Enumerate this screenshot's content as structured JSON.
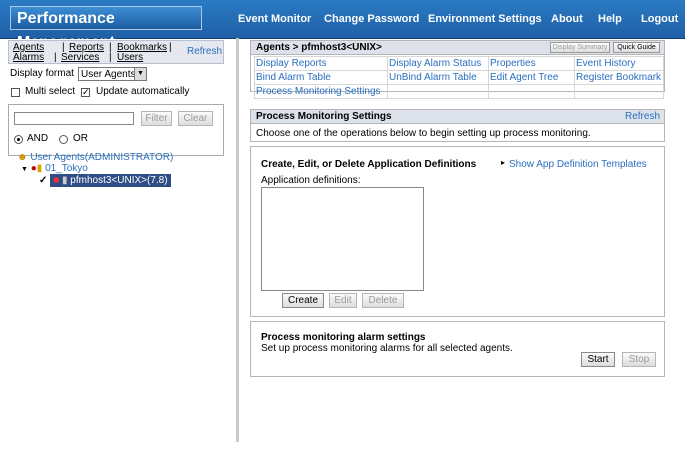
{
  "app": {
    "title": "Performance Management"
  },
  "topnav": {
    "event_monitor": "Event Monitor",
    "change_password": "Change Password",
    "environment_settings": "Environment Settings",
    "about": "About",
    "help": "Help",
    "logout": "Logout"
  },
  "left": {
    "tabs": {
      "agents": "Agents",
      "reports": "Reports",
      "bookmarks": "Bookmarks",
      "alarms": "Alarms",
      "services": "Services",
      "users": "Users",
      "refresh": "Refresh"
    },
    "display_format_label": "Display format",
    "display_format_value": "User Agents",
    "multi_select_label": "Multi select",
    "multi_select_checked": false,
    "update_auto_label": "Update automatically",
    "update_auto_checked": true,
    "filter_value": "",
    "filter_button": "Filter",
    "clear_button": "Clear",
    "and_label": "AND",
    "or_label": "OR",
    "logic_selected": "AND",
    "tree": {
      "root": "User Agents(ADMINISTRATOR)",
      "group": "01_Tokyo",
      "agent": "pfmhost3<UNIX>(7.8)"
    }
  },
  "right": {
    "breadcrumb": "Agents > pfmhost3<UNIX>",
    "display_summary": "Display Summary",
    "quick_guide": "Quick Guide",
    "operations": [
      [
        "Display Reports",
        "Display Alarm Status",
        "Properties",
        "Event History"
      ],
      [
        "Bind Alarm Table",
        "UnBind Alarm Table",
        "Edit Agent Tree",
        "Register Bookmark"
      ],
      [
        "Process Monitoring Settings",
        "",
        "",
        ""
      ]
    ],
    "pm_section": {
      "title": "Process Monitoring Settings",
      "refresh": "Refresh",
      "description": "Choose one of the operations below to begin setting up process monitoring."
    },
    "app_defs": {
      "title": "Create, Edit, or Delete Application Definitions",
      "templates_link": "Show App Definition Templates",
      "list_label": "Application definitions:",
      "create": "Create",
      "edit": "Edit",
      "delete": "Delete"
    },
    "alarm_settings": {
      "title": "Process monitoring alarm settings",
      "description": "Set up process monitoring alarms for all selected agents.",
      "start": "Start",
      "stop": "Stop"
    }
  }
}
